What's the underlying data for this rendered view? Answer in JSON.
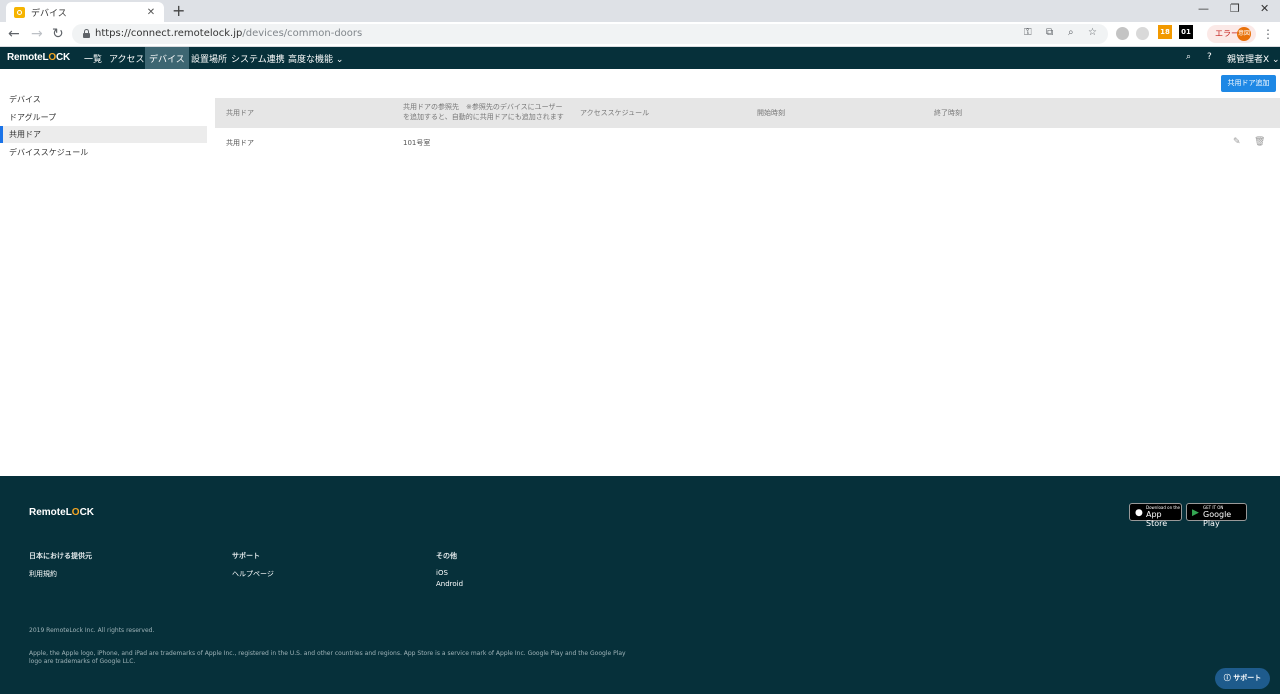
{
  "browser": {
    "tab_title": "デバイス",
    "url_host": "https://connect.remotelock.jp",
    "url_path": "/devices/common-doors",
    "profile_label": "エラー",
    "profile_avatar": "意図",
    "ext_badge_count": "18",
    "ext_counter": "01"
  },
  "appnav": {
    "logo_text_1": "Remote",
    "logo_text_2": "L",
    "logo_text_o": "O",
    "logo_text_3": "CK",
    "menu": [
      "一覧",
      "アクセス",
      "デバイス",
      "設置場所",
      "システム連携",
      "高度な機能 ⌄"
    ],
    "active_index": 2,
    "user_label": "親管理者X ⌄"
  },
  "sidebar": {
    "items": [
      "デバイス",
      "ドアグループ",
      "共用ドア",
      "デバイススケジュール"
    ],
    "active_index": 2
  },
  "main": {
    "add_button": "共用ドア追加",
    "columns": {
      "c1": "共用ドア",
      "c2_line1": "共用ドアの参照先　※参照先のデバイスにユーザー",
      "c2_line2": "を追加すると、自動的に共用ドアにも追加されます",
      "c3": "アクセススケジュール",
      "c4": "開始時刻",
      "c5": "終了時刻"
    },
    "rows": [
      {
        "name": "共用ドア",
        "ref": "101号室",
        "schedule": "",
        "start": "",
        "end": ""
      }
    ]
  },
  "footer": {
    "col1_head": "日本における提供元",
    "col1_link": "利用規約",
    "col2_head": "サポート",
    "col2_link": "ヘルプページ",
    "col3_head": "その他",
    "col3_links": [
      "iOS",
      "Android"
    ],
    "app_store_small": "Download on the",
    "app_store_big": "App Store",
    "google_play_small": "GET IT ON",
    "google_play_big": "Google Play",
    "copyright": "2019 RemoteLock Inc. All rights reserved.",
    "legal": "Apple, the Apple logo, iPhone, and iPad are trademarks of Apple Inc., registered in the U.S. and other countries and regions. App Store is a service mark of Apple Inc. Google Play and the Google Play logo are trademarks of Google LLC.",
    "support_button": "サポート"
  },
  "colors": {
    "nav_bg": "#06303a",
    "accent": "#1e88e5",
    "logo_accent": "#f5a623"
  }
}
